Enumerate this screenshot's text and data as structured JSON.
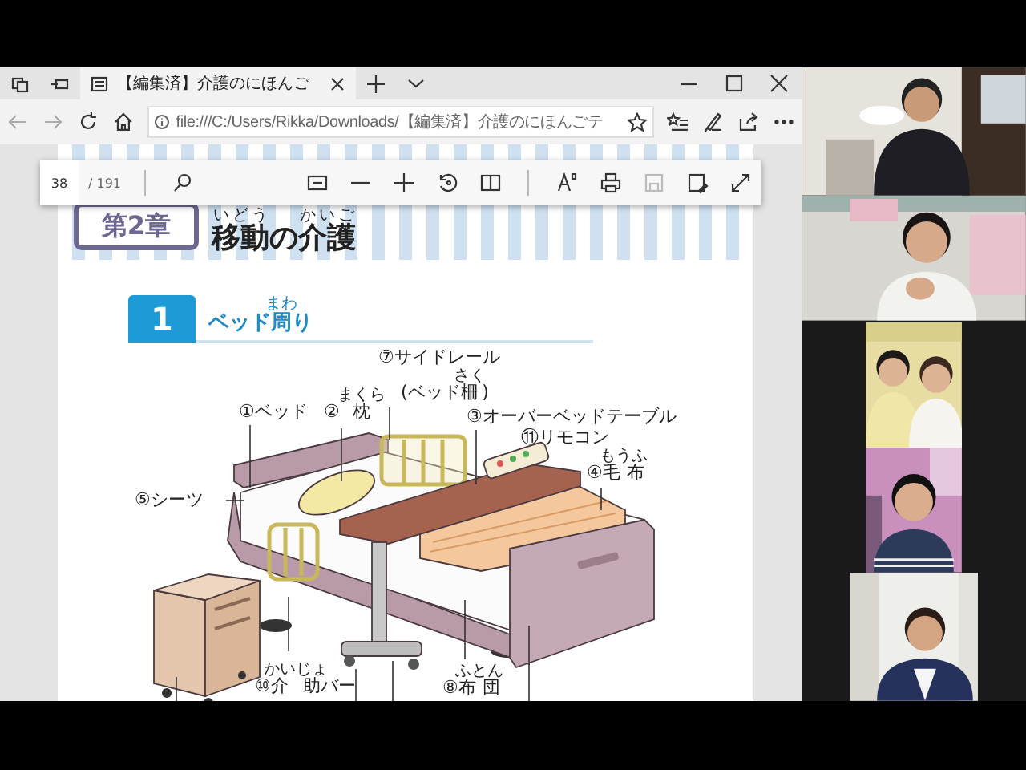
{
  "browser": {
    "tab_title": "【編集済】介護のにほんご",
    "address": "file:///C:/Users/Rikka/Downloads/【編集済】介護のにほんごテ"
  },
  "pdf_toolbar": {
    "page": "38",
    "page_count": "/ 191",
    "save_disabled": true
  },
  "document": {
    "chapter_badge": "第2章",
    "chapter_title": [
      {
        "text": "移動",
        "ruby": "いどう"
      },
      {
        "text": "の"
      },
      {
        "text": "介護",
        "ruby": "かいご"
      }
    ],
    "section_number": "1",
    "section_title": [
      {
        "text": "ベッド"
      },
      {
        "text": "周",
        "ruby": "まわ"
      },
      {
        "text": "り"
      }
    ],
    "labels": [
      {
        "parts": [
          {
            "text": "⑦サイドレール"
          }
        ]
      },
      {
        "parts": [
          {
            "text": "(ベッド"
          },
          {
            "text": "柵",
            "ruby": "さく"
          },
          {
            "text": ")"
          }
        ]
      },
      {
        "parts": [
          {
            "text": "①ベッド"
          }
        ]
      },
      {
        "parts": [
          {
            "text": "② "
          },
          {
            "text": "枕",
            "ruby": "まくら"
          }
        ]
      },
      {
        "parts": [
          {
            "text": "③オーバーベッドテーブル"
          }
        ]
      },
      {
        "parts": [
          {
            "text": "⑪リモコン"
          }
        ]
      },
      {
        "parts": [
          {
            "text": "④"
          },
          {
            "text": "毛布",
            "ruby": "もうふ"
          }
        ]
      },
      {
        "parts": [
          {
            "text": "⑤シーツ"
          }
        ]
      },
      {
        "parts": [
          {
            "text": "⑩"
          },
          {
            "text": "介助",
            "ruby": "かいじょ"
          },
          {
            "text": "バー"
          }
        ]
      },
      {
        "parts": [
          {
            "text": "⑧"
          },
          {
            "text": "布団",
            "ruby": "ふとん"
          }
        ]
      }
    ]
  }
}
